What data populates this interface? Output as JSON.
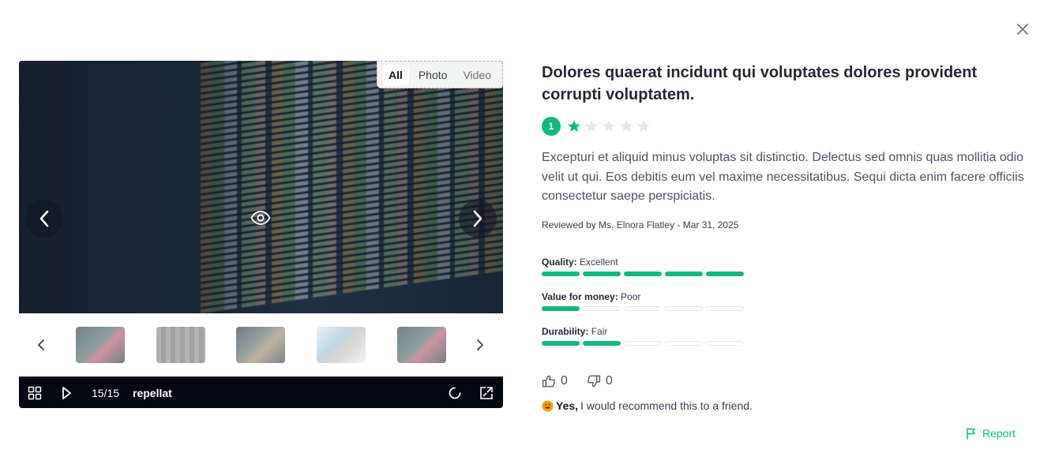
{
  "media": {
    "filter_tabs": [
      "All",
      "Photo",
      "Video"
    ],
    "active_tab": "All",
    "counter": "15/15",
    "caption": "repellat",
    "thumbnail_count": 5
  },
  "review": {
    "title": "Dolores quaerat incidunt qui voluptates dolores provident corrupti voluptatem.",
    "rating": "1",
    "rating_max": 5,
    "body": "Excepturi et aliquid minus voluptas sit distinctio. Delectus sed omnis quas mollitia odio velit ut qui. Eos debitis eum vel maxime necessitatibus. Sequi dicta enim facere officiis consectetur saepe perspiciatis.",
    "reviewed_by": "Reviewed by Ms. Elnora Flatley - Mar 31, 2025",
    "attributes": [
      {
        "label": "Quality:",
        "value": "Excellent",
        "score": 5,
        "max": 5
      },
      {
        "label": "Value for money:",
        "value": "Poor",
        "score": 1,
        "max": 5
      },
      {
        "label": "Durability:",
        "value": "Fair",
        "score": 2,
        "max": 5
      }
    ],
    "helpful_up": "0",
    "helpful_down": "0",
    "recommend_yes": "Yes,",
    "recommend_text": "I would recommend this to a friend.",
    "report_label": "Report"
  },
  "colors": {
    "accent": "#10b981",
    "toolbar": "#030712",
    "title": "#1f2937"
  },
  "icons": [
    "close-icon",
    "chevron-left-icon",
    "chevron-right-icon",
    "eye-icon",
    "grid-icon",
    "play-icon",
    "refresh-icon",
    "fullscreen-icon",
    "thumbs-up-icon",
    "thumbs-down-icon",
    "flag-icon",
    "star-icon",
    "emoji-icon"
  ]
}
